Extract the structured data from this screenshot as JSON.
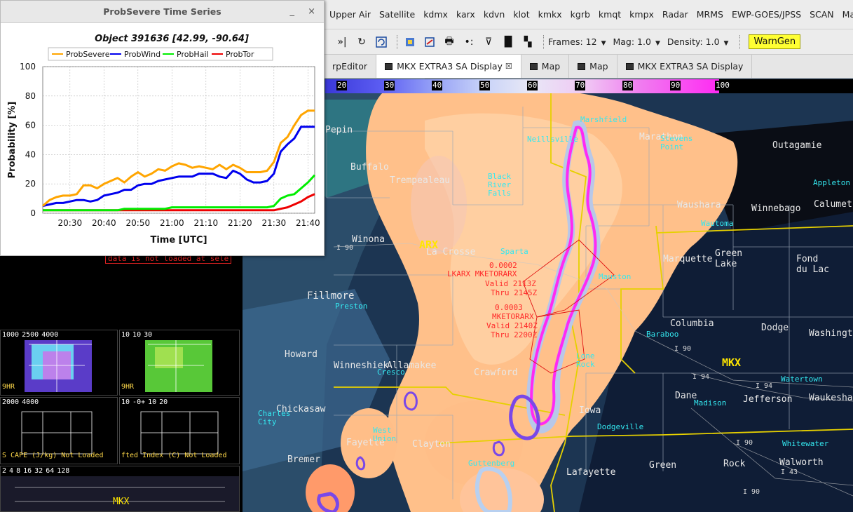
{
  "menubar": {
    "items": [
      "Upper Air",
      "Satellite",
      "kdmx",
      "karx",
      "kdvn",
      "klot",
      "kmkx",
      "kgrb",
      "kmqt",
      "kmpx",
      "Radar",
      "MRMS",
      "EWP-GOES/JPSS",
      "SCAN",
      "Maps"
    ]
  },
  "toolbar": {
    "frames_label": "Frames: 12",
    "mag_label": "Mag: 1.0",
    "density_label": "Density: 1.0",
    "warngen_label": "WarnGen",
    "icons": [
      "skip-end-icon",
      "loop-icon",
      "refresh-icon",
      "image-properties-icon",
      "clear-icon",
      "print-icon",
      "points-icon",
      "sample-icon",
      "panel-layout-icon",
      "four-panel-icon"
    ]
  },
  "tabs": [
    {
      "label": "rpEditor",
      "active": false,
      "icon": false,
      "closable": false
    },
    {
      "label": "MKX EXTRA3 SA Display",
      "active": true,
      "icon": true,
      "closable": true
    },
    {
      "label": "Map",
      "active": false,
      "icon": true,
      "closable": false
    },
    {
      "label": "Map",
      "active": false,
      "icon": true,
      "closable": false
    },
    {
      "label": "MKX EXTRA3 SA Display",
      "active": false,
      "icon": true,
      "closable": false
    }
  ],
  "colorbar": {
    "ticks": [
      "20",
      "30",
      "40",
      "50",
      "60",
      "70",
      "80",
      "90",
      "100"
    ]
  },
  "popup": {
    "title": "ProbSevere Time Series",
    "minimize_glyph": "_",
    "close_glyph": "×"
  },
  "chart_data": {
    "type": "line",
    "title": "Object 391636 [42.99, -90.64]",
    "xlabel": "Time [UTC]",
    "ylabel": "Probability [%]",
    "ylim": [
      0,
      100
    ],
    "xlim": [
      "20:22",
      "21:42"
    ],
    "xticks": [
      "20:30",
      "20:40",
      "20:50",
      "21:00",
      "21:10",
      "21:20",
      "21:30",
      "21:40"
    ],
    "yticks": [
      0,
      20,
      40,
      60,
      80,
      100
    ],
    "grid": true,
    "legend_position": "top",
    "x": [
      "20:22",
      "20:24",
      "20:26",
      "20:28",
      "20:30",
      "20:32",
      "20:34",
      "20:36",
      "20:38",
      "20:40",
      "20:42",
      "20:44",
      "20:46",
      "20:48",
      "20:50",
      "20:52",
      "20:54",
      "20:56",
      "20:58",
      "21:00",
      "21:02",
      "21:04",
      "21:06",
      "21:08",
      "21:10",
      "21:12",
      "21:14",
      "21:16",
      "21:18",
      "21:20",
      "21:22",
      "21:24",
      "21:26",
      "21:28",
      "21:30",
      "21:32",
      "21:34",
      "21:36",
      "21:38",
      "21:40",
      "21:42"
    ],
    "series": [
      {
        "name": "ProbSevere",
        "color": "#ffa500",
        "values": [
          5,
          9,
          11,
          12,
          12,
          13,
          19,
          19,
          17,
          20,
          22,
          24,
          21,
          25,
          28,
          25,
          27,
          30,
          29,
          32,
          34,
          33,
          31,
          32,
          31,
          30,
          33,
          30,
          33,
          31,
          28,
          28,
          28,
          29,
          35,
          48,
          52,
          60,
          67,
          70,
          70
        ]
      },
      {
        "name": "ProbWind",
        "color": "#0000ee",
        "values": [
          5,
          6,
          7,
          7,
          8,
          9,
          9,
          8,
          9,
          12,
          13,
          14,
          16,
          16,
          19,
          20,
          20,
          22,
          23,
          24,
          25,
          25,
          25,
          27,
          27,
          27,
          25,
          24,
          29,
          27,
          23,
          21,
          21,
          22,
          27,
          42,
          47,
          51,
          59,
          59,
          59
        ]
      },
      {
        "name": "ProbHail",
        "color": "#00ee00",
        "values": [
          2,
          2,
          2,
          2,
          2,
          2,
          2,
          2,
          2,
          2,
          2,
          2,
          3,
          3,
          3,
          3,
          3,
          3,
          3,
          4,
          4,
          4,
          4,
          4,
          4,
          4,
          4,
          4,
          4,
          4,
          4,
          4,
          4,
          4,
          5,
          10,
          12,
          13,
          17,
          21,
          26
        ]
      },
      {
        "name": "ProbTor",
        "color": "#ee0000",
        "values": [
          2,
          2,
          2,
          2,
          2,
          2,
          2,
          2,
          2,
          2,
          2,
          2,
          2,
          2,
          2,
          2,
          2,
          2,
          2,
          2,
          2,
          2,
          2,
          2,
          2,
          2,
          2,
          2,
          2,
          2,
          2,
          2,
          2,
          2,
          2,
          3,
          4,
          6,
          8,
          11,
          13
        ]
      }
    ]
  },
  "map": {
    "county_labels": [
      "Pepin",
      "Buffalo",
      "Trempealeau",
      "Winona",
      "La Crosse",
      "Fillmore",
      "Howard",
      "Winneshiek",
      "Allamakee",
      "Chickasaw",
      "Fayette",
      "Clayton",
      "Bremer",
      "Marathon",
      "Outagamie",
      "Waushara",
      "Winnebago",
      "Calumet",
      "Green Lake",
      "Fond du Lac",
      "Marquette",
      "Columbia",
      "Dodge",
      "Washington",
      "Dane",
      "Jefferson",
      "Waukesha",
      "Iowa",
      "Green",
      "Rock",
      "Walworth",
      "Lafayette",
      "Crawford",
      "MKX",
      "ARX"
    ],
    "city_labels": [
      "Neillsville",
      "Marshfield",
      "Stevens Point",
      "Black River Falls",
      "Sparta",
      "Mauston",
      "Baraboo",
      "Madison",
      "Watertown",
      "Dodgeville",
      "Whitewater",
      "West Union",
      "Guttenberg",
      "Preston",
      "Cresco",
      "Appleton",
      "Wautoma",
      "Lone Rock",
      "Charles City"
    ],
    "warning_texts": [
      "LKARX MKETORARX",
      "0.0002",
      "Valid 2113Z",
      "Thru 2145Z",
      "0.0003",
      "MKETORARX",
      "Valid 2140Z",
      "Thru 2200Z"
    ],
    "highway_labels": [
      "I 90",
      "I 94",
      "I 43"
    ]
  },
  "left_panels": {
    "banner": "data is not loaded at sele",
    "panel1_scale": [
      "1000",
      "2500",
      "4000"
    ],
    "panel1_label": "9HR",
    "panel2_scale": [
      "10",
      "10",
      "30"
    ],
    "panel2_label": "9HR",
    "panel3_scale": [
      "2000",
      "4000"
    ],
    "panel3_label": "S CAPE (J/kg) Not Loaded",
    "panel4_scale": [
      "10",
      "-0+",
      "10",
      "20"
    ],
    "panel4_label": "fted Index (C) Not Loaded",
    "panel5_scale": [
      "2",
      "4",
      "8",
      "16",
      "32",
      "64",
      "128"
    ],
    "panel5_label": "MKX"
  }
}
